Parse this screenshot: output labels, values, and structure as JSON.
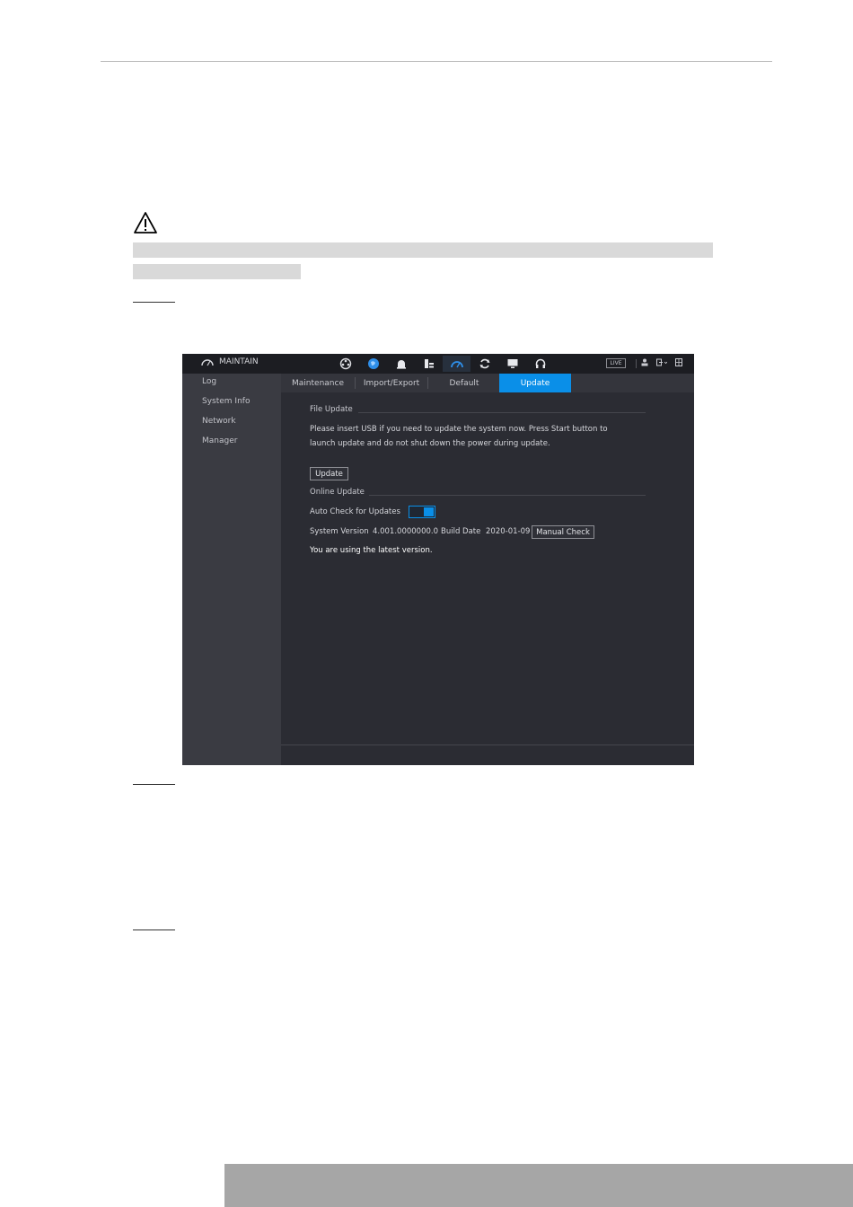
{
  "app": {
    "title": "MAINTAIN",
    "live_label": "LIVE",
    "nav_icons": [
      "camera-icon",
      "network-icon",
      "alarm-icon",
      "storage-icon",
      "maintain-icon",
      "backup-icon",
      "display-icon",
      "audio-icon"
    ],
    "active_nav": 4
  },
  "sidebar": {
    "items": [
      {
        "label": "Log"
      },
      {
        "label": "System Info"
      },
      {
        "label": "Network"
      },
      {
        "label": "Manager"
      }
    ]
  },
  "tabs": [
    {
      "label": "Maintenance"
    },
    {
      "label": "Import/Export"
    },
    {
      "label": "Default"
    },
    {
      "label": "Update"
    }
  ],
  "active_tab": "Update",
  "file_update": {
    "section_label": "File Update",
    "line1": "Please insert USB if you need to update the system now. Press Start button to",
    "line2": "launch update and do not shut down the power during update.",
    "button_label": "Update"
  },
  "online_update": {
    "section_label": "Online Update",
    "auto_check_label": "Auto Check for Updates",
    "auto_check_enabled": true,
    "system_version_label": "System Version",
    "system_version_value": "4.001.0000000.0",
    "build_date_label": "Build Date",
    "build_date_value": "2020-01-09",
    "manual_check_label": "Manual Check",
    "status_text": "You are using the latest version."
  },
  "colors": {
    "accent": "#0a8fe8",
    "panel": "#2b2c33",
    "sidebar": "#3a3b42",
    "topbar": "#1c1d22"
  }
}
